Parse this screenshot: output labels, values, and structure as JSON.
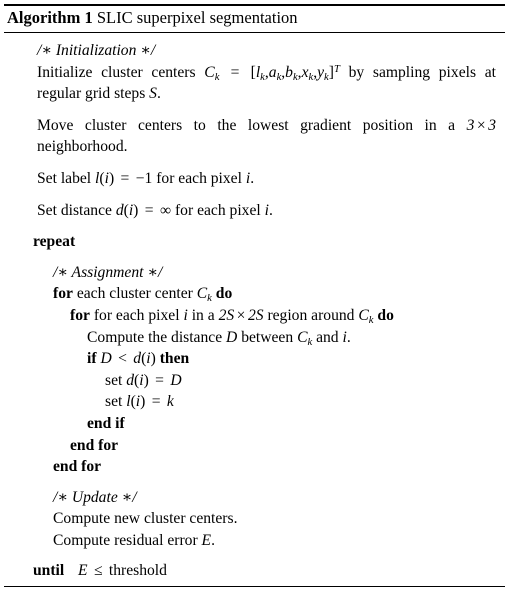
{
  "header": {
    "keyword": "Algorithm 1",
    "title": "SLIC superpixel segmentation"
  },
  "body": {
    "comment_initialization": "/∗ Initialization ∗/",
    "init_line": "Initialize cluster centers Ck = [lk, ak, bk, xk, yk]T by sampling pixels at regular grid steps S.",
    "move_line": "Move cluster centers to the lowest gradient position in a 3 × 3 neighborhood.",
    "set_label": "Set label l(i) = −1 for each pixel i.",
    "set_distance": "Set distance d(i) = ∞ for each pixel i.",
    "repeat": "repeat",
    "comment_assignment": "/∗ Assignment ∗/",
    "for_center": "for each cluster center Ck do",
    "for_pixel": "for each pixel i in a 2S × 2S region around Ck do",
    "compute_distance": "Compute the distance D between Ck and i.",
    "if_cond": "if D < d(i) then",
    "set_d": "set d(i) = D",
    "set_l": "set l(i) = k",
    "end_if": "end if",
    "end_for_inner": "end for",
    "end_for_outer": "end for",
    "comment_update": "/∗ Update ∗/",
    "compute_centers": "Compute new cluster centers.",
    "compute_error": "Compute residual error E.",
    "until": "until  E ≤ threshold"
  },
  "tokens": {
    "kw_for": "for",
    "kw_do": "do",
    "kw_if": "if",
    "kw_then": "then",
    "kw_end_if": "end if",
    "kw_end_for": "end for",
    "kw_repeat": "repeat",
    "kw_until": "until",
    "t_initialize": "Initialize cluster centers",
    "t_by": "by",
    "t_sampling": "sampling pixels at regular grid steps",
    "t_move": "Move cluster centers to the lowest gradient position in a",
    "t_neighborhood": "neighborhood.",
    "t_set_label": "Set label",
    "t_set_distance": "Set distance",
    "t_for_each_pixel": "for each pixel",
    "t_each_cluster_center": "each cluster center",
    "t_in_a": "in a",
    "t_region_around": "region around",
    "t_compute_distance": "Compute the distance",
    "t_between": "between",
    "t_and": "and",
    "t_set": "set",
    "t_each_pixel_end": "for each pixel",
    "t_compute_centers": "Compute new cluster centers.",
    "t_compute_error": "Compute residual error",
    "t_threshold": "threshold",
    "t_each": "each",
    "sym_eq": "=",
    "sym_lt": "<",
    "sym_le": "≤",
    "sym_times": "×",
    "sym_inf": "∞",
    "sym_minus1": "−1",
    "sym_period": ".",
    "sym_comma": ","
  },
  "style": {
    "text_color": "#000000",
    "background": "#ffffff"
  }
}
